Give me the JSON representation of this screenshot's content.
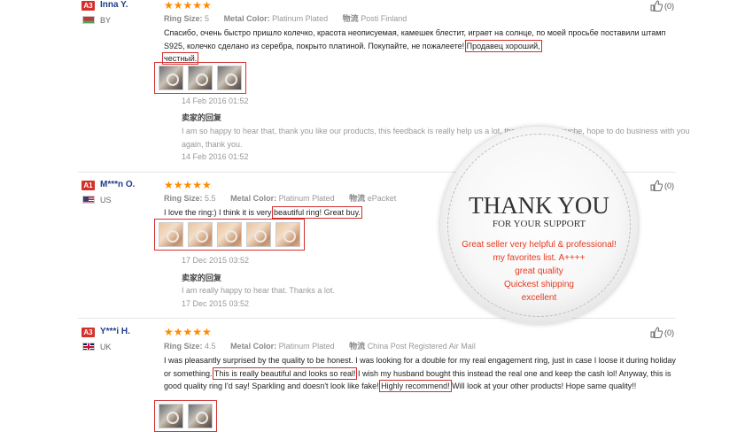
{
  "reviews": [
    {
      "badge": "A3",
      "name": "Inna Y.",
      "country": "BY",
      "stars": "★★★★★",
      "size_label": "Ring Size:",
      "size": "5",
      "color_label": "Metal Color:",
      "color": "Platinum Plated",
      "ship_label": "物流",
      "ship": "Posti Finland",
      "text_a": "Спасибо, очень быстро пришло колечко, красота неописуемая, камешек блестит, играет на солнце, по моей просьбе поставили штамп S925, колечко сделано из серебра, покрыто платиной. Покупайте, не пожалеете! ",
      "text_hl1": "Продавец хороший,",
      "text_hl2": "честный.",
      "date": "14 Feb 2016 01:52",
      "seller_label": "卖家的回复",
      "reply": "I am so happy to hear that, thank you like our products, this feedback is really help us a lot, thank you very muche, hope to do business with you again, thank you.",
      "reply_date": "14 Feb 2016 01:52",
      "helpful": "(0)"
    },
    {
      "badge": "A1",
      "name": "M***n O.",
      "country": "US",
      "stars": "★★★★★",
      "size_label": "Ring Size:",
      "size": "5.5",
      "color_label": "Metal Color:",
      "color": "Platinum Plated",
      "ship_label": "物流",
      "ship": "ePacket",
      "text_a": "I love the ring:) I think it is very ",
      "text_hl1": "beautiful ring! Great buy.",
      "date": "17 Dec 2015 03:52",
      "seller_label": "卖家的回复",
      "reply": "I am really happy to hear that. Thanks a lot.",
      "reply_date": "17 Dec 2015 03:52",
      "helpful": "(0)"
    },
    {
      "badge": "A3",
      "name": "Y***i H.",
      "country": "UK",
      "stars": "★★★★★",
      "size_label": "Ring Size:",
      "size": "4.5",
      "color_label": "Metal Color:",
      "color": "Platinum Plated",
      "ship_label": "物流",
      "ship": "China Post Registered Air Mail",
      "text_a": "I was pleasantly surprised by the quality to be honest. I was looking for a double for my real engagement ring, just in case I loose it during holiday or something. ",
      "text_hl1": "This is really beautiful and looks so real!",
      "text_b": " I wish my husband bought this instead the real one and keep the cash lol! Anyway, this is good quality ring I'd say! Sparkling and doesn't look like fake! ",
      "text_hl2": "Highly recommend!",
      "text_c": " Will look at your other products! Hope same quality!!",
      "helpful": "(0)"
    }
  ],
  "stamp": {
    "title": "THANK YOU",
    "subtitle": "FOR YOUR SUPPORT",
    "lines": [
      "Great seller very helpful & professional!",
      "my favorites list. A++++",
      "great quality",
      "Quickest shipping",
      "excellent"
    ]
  },
  "colors": {
    "star": "#ff8a00",
    "badge": "#d4312a",
    "highlight": "#d32f2f",
    "name": "#1e3d8f"
  }
}
